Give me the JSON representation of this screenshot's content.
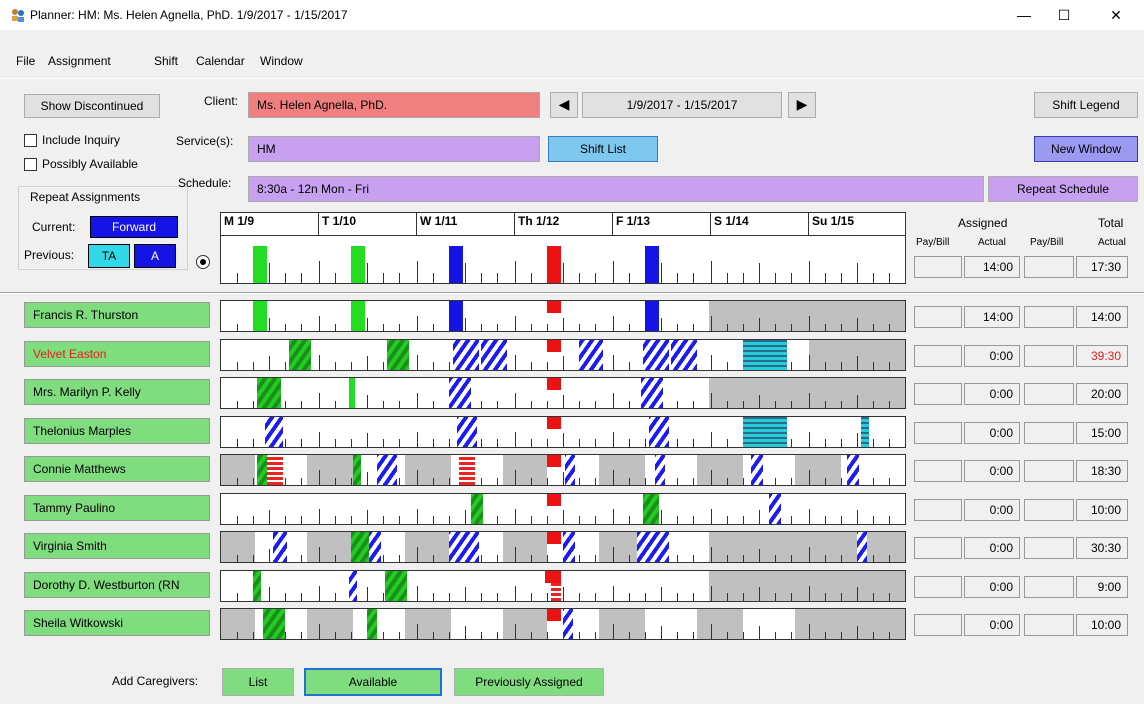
{
  "window": {
    "title": "Planner: HM: Ms. Helen Agnella, PhD.  1/9/2017 - 1/15/2017",
    "minimize": "—",
    "maximize": "☐",
    "close": "✕"
  },
  "menu": [
    "File",
    "Assignment",
    "Shift",
    "Calendar",
    "Window"
  ],
  "controls": {
    "show_discontinued": "Show Discontinued",
    "include_inquiry": "Include Inquiry",
    "possibly_available": "Possibly Available",
    "repeat_assignments": "Repeat Assignments",
    "current_label": "Current:",
    "current_value": "Forward",
    "previous_label": "Previous:",
    "previous_ta": "TA",
    "previous_a": "A",
    "client_label": "Client:",
    "client_value": "Ms. Helen Agnella, PhD.",
    "services_label": "Service(s):",
    "services_value": "HM",
    "schedule_label": "Schedule:",
    "schedule_value": "8:30a - 12n Mon - Fri",
    "date_range": "1/9/2017 - 1/15/2017",
    "shift_list": "Shift List",
    "shift_legend": "Shift Legend",
    "new_window": "New Window",
    "repeat_schedule": "Repeat Schedule"
  },
  "days": [
    "M 1/9",
    "T 1/10",
    "W 1/11",
    "Th 1/12",
    "F 1/13",
    "S 1/14",
    "Su 1/15"
  ],
  "totals_header": {
    "assigned": "Assigned",
    "total": "Total",
    "paybill1": "Pay/Bill",
    "actual1": "Actual",
    "paybill2": "Pay/Bill",
    "actual2": "Actual"
  },
  "schedule_row": {
    "assigned_actual": "14:00",
    "total_actual": "17:30"
  },
  "caregivers": [
    {
      "name": "Francis R. Thurston",
      "assigned": "14:00",
      "total": "14:00",
      "name_color": "#000000",
      "total_color": "#000000"
    },
    {
      "name": "Velvet Easton",
      "assigned": "0:00",
      "total": "39:30",
      "name_color": "#e02020",
      "total_color": "#e02020"
    },
    {
      "name": "Mrs. Marilyn P. Kelly",
      "assigned": "0:00",
      "total": "20:00",
      "name_color": "#000000",
      "total_color": "#000000"
    },
    {
      "name": "Thelonius Marples",
      "assigned": "0:00",
      "total": "15:00",
      "name_color": "#000000",
      "total_color": "#000000"
    },
    {
      "name": "Connie Matthews",
      "assigned": "0:00",
      "total": "18:30",
      "name_color": "#000000",
      "total_color": "#000000"
    },
    {
      "name": "Tammy Paulino",
      "assigned": "0:00",
      "total": "10:00",
      "name_color": "#000000",
      "total_color": "#000000"
    },
    {
      "name": "Virginia Smith",
      "assigned": "0:00",
      "total": "30:30",
      "name_color": "#000000",
      "total_color": "#000000"
    },
    {
      "name": "Dorothy D. Westburton (RN",
      "assigned": "0:00",
      "total": "9:00",
      "name_color": "#000000",
      "total_color": "#000000"
    },
    {
      "name": "Sheila Witkowski",
      "assigned": "0:00",
      "total": "10:00",
      "name_color": "#000000",
      "total_color": "#000000"
    }
  ],
  "add_caregivers": {
    "label": "Add Caregivers:",
    "list": "List",
    "available": "Available",
    "previously_assigned": "Previously Assigned"
  },
  "colors": {
    "client": "#f08080",
    "service": "#c8a0f0",
    "green": "#7fdc7f",
    "blue_button": "#1414e6",
    "cyan_button": "#30d8e8",
    "new_window": "#9a9af0",
    "shift_list": "#7ec8f0"
  }
}
